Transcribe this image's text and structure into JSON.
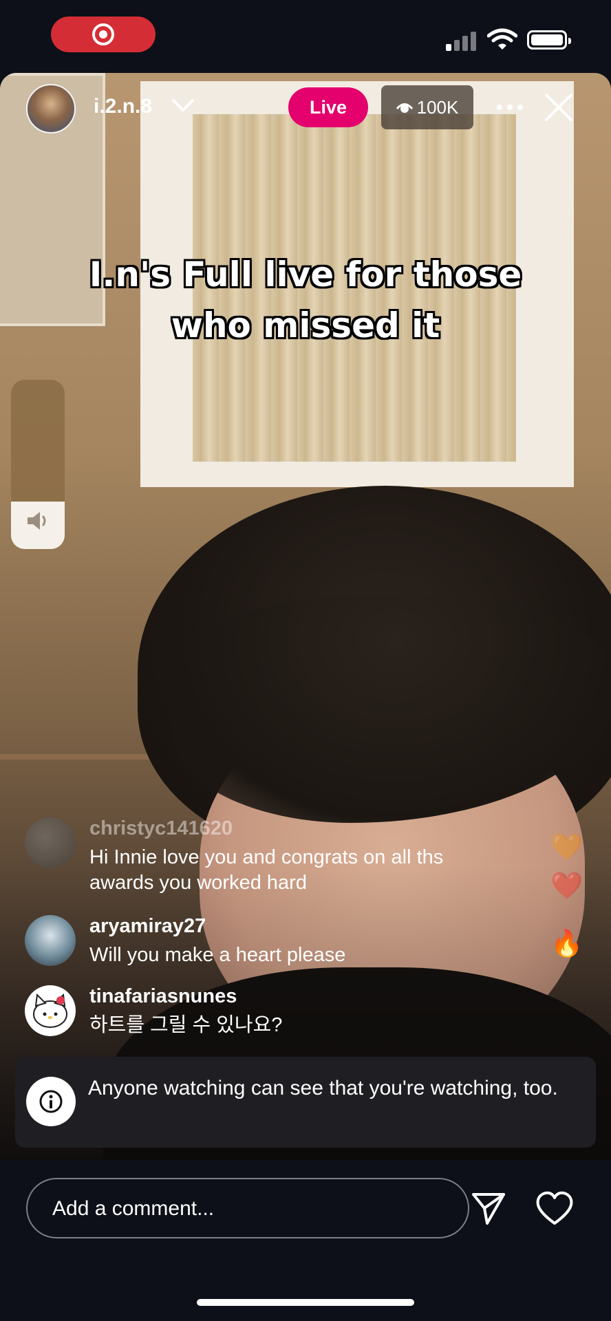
{
  "status_bar": {
    "recording_icon": "record-icon",
    "signal_icon": "cellular-signal-icon",
    "wifi_icon": "wifi-icon",
    "battery_icon": "battery-icon"
  },
  "header": {
    "username": "i.2.n.8",
    "live_label": "Live",
    "viewer_count": "100K",
    "eye_icon": "eye-icon",
    "more_icon": "more-options-icon",
    "close_icon": "close-icon"
  },
  "caption": {
    "line1": "I.n's Full live for those",
    "line2": "who missed it"
  },
  "volume": {
    "level": 0.28,
    "icon": "speaker-icon"
  },
  "comments": [
    {
      "user": "christyc141620",
      "text": "Hi Innie love you and congrats on all ths awards you worked hard",
      "faded": true
    },
    {
      "user": "aryamiray27",
      "text": "Will you make a heart please",
      "faded": false
    },
    {
      "user": "tinafariasnunes",
      "text": "하트를 그릴 수 있나요?",
      "faded": false
    }
  ],
  "reactions": [
    "🧡",
    "❤️",
    "🔥"
  ],
  "notice": {
    "text": "Anyone watching can see that you're watching, too.",
    "icon": "info-icon"
  },
  "composer": {
    "placeholder": "Add a comment...",
    "send_icon": "send-icon",
    "like_icon": "heart-icon"
  },
  "colors": {
    "live_badge": "#e4006d",
    "record_pill": "#d42d35",
    "background": "#0d1018"
  }
}
